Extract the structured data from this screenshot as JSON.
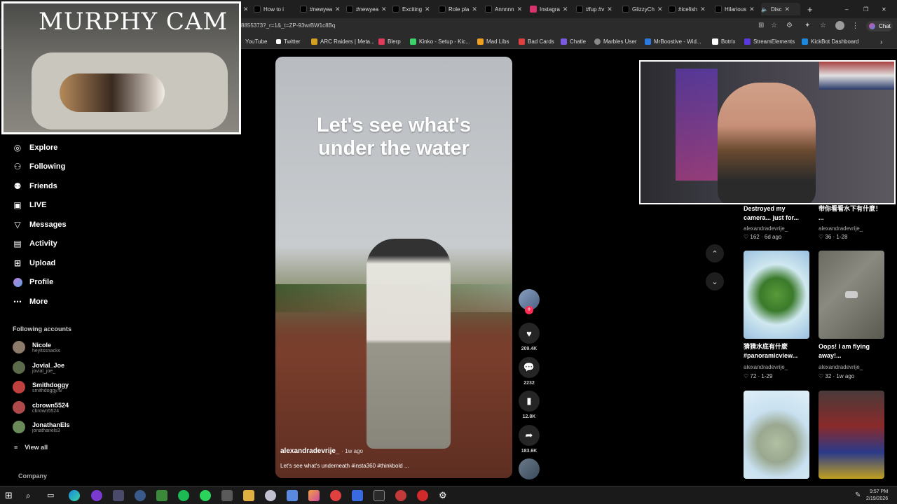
{
  "browser": {
    "tabs": [
      "How to i",
      "#newyea",
      "#newyea",
      "Exciting",
      "Role pla",
      "Annnnn",
      "Instagra",
      "#fup #v",
      "GlizzyCh",
      "#icefish",
      "Hilarious",
      "Disc"
    ],
    "url_fragment": "8855373?_r=1&_t=ZP-93wrBW1c8Bq",
    "profile_label": "Chat",
    "bookmarks": [
      "YouTube",
      "Twitter",
      "ARC Raiders | Meta...",
      "Blerp",
      "Kinko - Setup - Kic...",
      "Mad Libs",
      "Bad Cards",
      "Chatle",
      "Marbles User",
      "MrBoostive - Wid...",
      "Botrix",
      "StreamElements",
      "KickBot Dashboard"
    ],
    "bookmark_colors": [
      "#ff0000",
      "#ffffff",
      "#d4a020",
      "#e23a5a",
      "#3ad46a",
      "#f0a020",
      "#e04040",
      "#7a5ae0",
      "#8a8a8a",
      "#2a7ae0",
      "#ffffff",
      "#5a3ae0",
      "#1a8ae0"
    ]
  },
  "overlay": {
    "murphy_title": "MURPHY CAM"
  },
  "sidebar": {
    "nav": [
      {
        "label": "Explore",
        "icon": "compass-icon"
      },
      {
        "label": "Following",
        "icon": "user-check-icon"
      },
      {
        "label": "Friends",
        "icon": "friends-icon"
      },
      {
        "label": "LIVE",
        "icon": "live-icon"
      },
      {
        "label": "Messages",
        "icon": "send-icon"
      },
      {
        "label": "Activity",
        "icon": "activity-icon"
      },
      {
        "label": "Upload",
        "icon": "plus-square-icon"
      },
      {
        "label": "Profile",
        "icon": "avatar-icon"
      },
      {
        "label": "More",
        "icon": "more-icon"
      }
    ],
    "following_title": "Following accounts",
    "accounts": [
      {
        "name": "Nicole",
        "handle": "heyitssnacks",
        "color": "#8c7a6a"
      },
      {
        "name": "Jovial_Joe",
        "handle": "jovial_joe_",
        "color": "#5a6a4a"
      },
      {
        "name": "Smithdoggy",
        "handle": "smithdoggy.tv",
        "color": "#c04040"
      },
      {
        "name": "cbrown5524",
        "handle": "cbrown5524",
        "color": "#b04a4a"
      },
      {
        "name": "JonathanEls",
        "handle": "jonathanels3",
        "color": "#6a8a5a"
      }
    ],
    "view_all": "View all",
    "company": "Company"
  },
  "video": {
    "caption_line1": "Let's see what's",
    "caption_line2": "under the water",
    "author": "alexandradevrije_",
    "time": "· 1w ago",
    "description": "Let's  see what's underneath #insta360 #thinkbold ..."
  },
  "actions": {
    "likes": "209.4K",
    "comments": "2232",
    "saves": "12.8K",
    "shares": "183.6K"
  },
  "grid": [
    {
      "caption": "Destroyed my camera... just for...",
      "author": "alexandradevrije_",
      "likes": "162",
      "date": "6d ago"
    },
    {
      "caption": "带你看看水下有什麼！ ...",
      "author": "alexandradevrije_",
      "likes": "36",
      "date": "1-28"
    },
    {
      "caption": "猜猜水底有什麼 #panoramicview...",
      "author": "alexandradevrije_",
      "likes": "72",
      "date": "1-29"
    },
    {
      "caption": "Oops! I am flying away!...",
      "author": "alexandradevrije_",
      "likes": "32",
      "date": "1w ago"
    }
  ],
  "taskbar": {
    "time": "9:57 PM",
    "date": "2/19/2026"
  }
}
